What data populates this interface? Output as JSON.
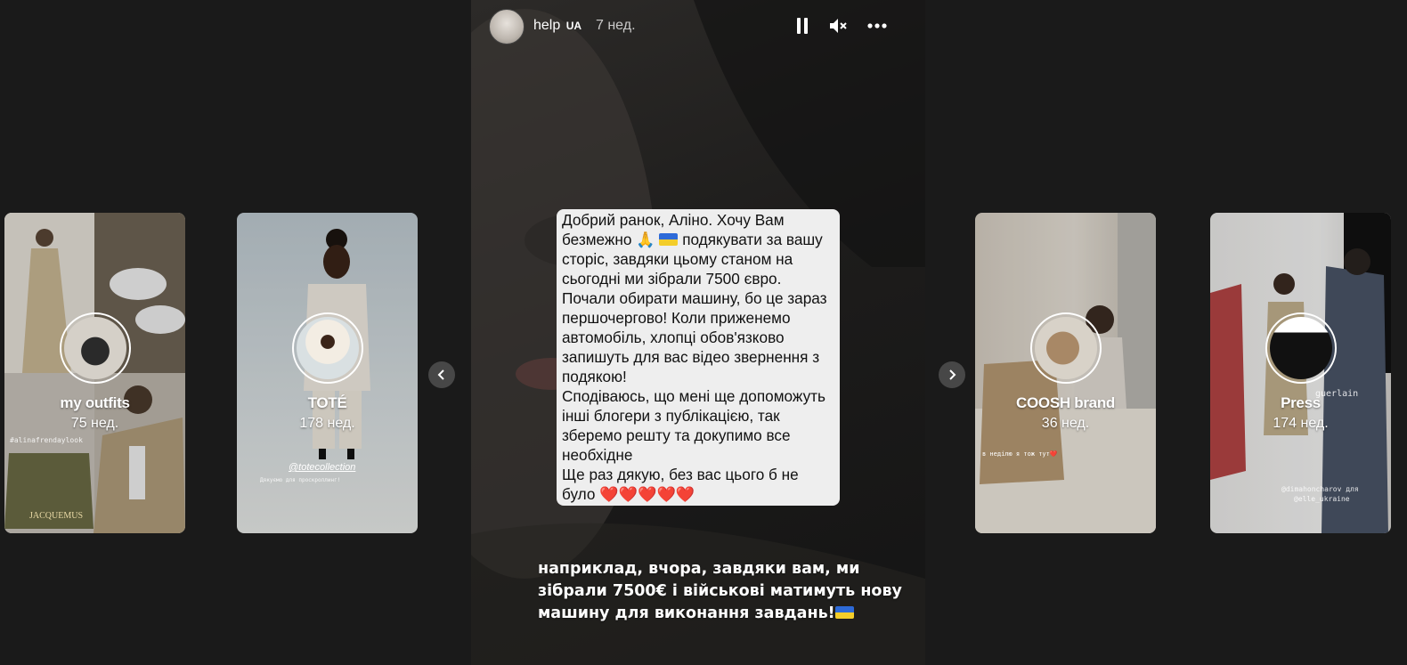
{
  "main_story": {
    "username": "help",
    "username_badge": "UA",
    "time_ago": "7 нед.",
    "message": [
      "Добрий ранок, Аліно. Хочу Вам",
      "безмежно 🙏",
      "подякувати за вашу",
      "сторіс, завдяки цьому станом на",
      "сьогодні ми зібрали 7500 євро.",
      "Почали обирати машину, бо це зараз",
      "першочергово! Коли приженемо",
      "автомобіль, хлопці обов'язково",
      "запишуть для вас відео звернення з",
      "подякою!",
      "Сподіваюсь, що мені ще допоможуть",
      "інші блогери з публікацією, так",
      "зберемо решту та докупимо все",
      "необхідне",
      "Ще раз дякую, без вас цього б не",
      "було",
      "❤️❤️❤️❤️❤️"
    ],
    "caption": [
      "наприклад, вчора, завдяки вам, ми",
      "зібрали 7500€ і військові матимуть нову",
      "машину для виконання завдань!"
    ]
  },
  "side_stories": [
    {
      "name": "my outfits",
      "age": "75 нед.",
      "note": "#alinafrendaylook",
      "brand": "JACQUEMUS"
    },
    {
      "name": "TOTÉ",
      "age": "178 нед.",
      "note": "@totecollection",
      "note2": "Дякуємо для проскроллинг!"
    },
    {
      "name": "COOSH brand",
      "age": "36 нед.",
      "note": "в неділю я тож тут❤️"
    },
    {
      "name": "Press",
      "age": "174 нед.",
      "note": "@dimahoncharov для",
      "note2": "@elle_ukraine",
      "brand": "guerlain"
    }
  ],
  "colors": {
    "background": "#1a1a1a",
    "bubble": "#eeeeee",
    "heart": "#e8202f"
  },
  "icons": [
    "pause-icon",
    "mute-icon",
    "more-icon",
    "chevron-left-icon",
    "chevron-right-icon"
  ]
}
